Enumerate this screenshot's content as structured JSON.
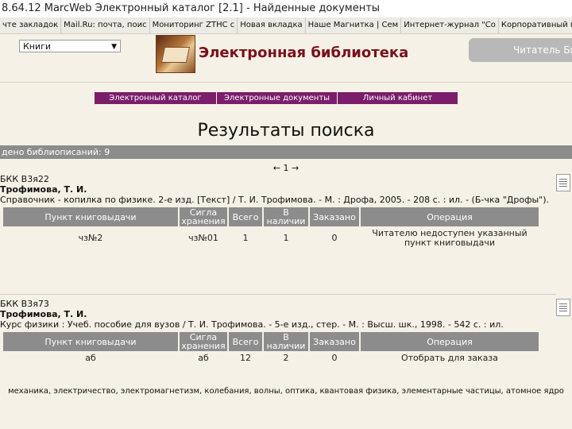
{
  "browser": {
    "title": "8.64.12 MarcWeb Электронный каталог [2.1] - Найденные документы",
    "bookmarks": [
      "чте закладок",
      "Mail.Ru: почта, поис",
      "Мониторинг ZTHC с",
      "Новая вкладка",
      "Наше Магнитка | Сем",
      "Интернет-журнал \"Со",
      "Корпоративный порта"
    ]
  },
  "header": {
    "search_select": "Книги",
    "site_title": "Электронная библиотека",
    "reader_button": "Читатель Би"
  },
  "nav": {
    "tabs": [
      "Электронный каталог",
      "Электронные документы",
      "Личный кабинет"
    ]
  },
  "page_title": "Результаты поиска",
  "found_text": "дено библиописаний: 9",
  "pager": "← 1 →",
  "holdings_headers": [
    "Пункт книговыдачи",
    "Сигла хранения",
    "Всего",
    "В наличии",
    "Заказано",
    "Операция"
  ],
  "records": [
    {
      "bbk": "БКК В3я22",
      "author": "Трофимова, Т. И.",
      "description": "Справочник - копилка по физике. 2-е изд. [Текст] / Т. И. Трофимова. - М. : Дрофа, 2005. - 208 с. : ил. - (Б-чка \"Дрофы\").",
      "rows": [
        {
          "point": "чз№2",
          "sigla": "чз№01",
          "total": "1",
          "available": "1",
          "ordered": "0",
          "operation": "Читателю недоступен указанный пункт книговыдачи"
        }
      ]
    },
    {
      "bbk": "БКК В3я73",
      "author": "Трофимова, Т. И.",
      "description": "Курс физики : Учеб. пособие для вузов / Т. И. Трофимова. - 5-е изд., стер. - М. : Высш. шк., 1998. - 542 с. : ил.",
      "rows": [
        {
          "point": "аб",
          "sigla": "аб",
          "total": "12",
          "available": "2",
          "ordered": "0",
          "operation": "Отобрать для заказа"
        }
      ]
    }
  ],
  "subjects": "механика, электричество, электромагнетизм, колебания, волны, оптика, квантовая физика, элементарные частицы, атомное ядро",
  "colors": {
    "page_bg": "#f5f1e6",
    "nav_bg": "#7a1d6b",
    "site_title": "#7a0f1c",
    "header_gray": "#8c8c8c",
    "link": "#1b2ba0"
  },
  "icons": {
    "logo": "library-logo",
    "record": "record-document-icon"
  }
}
